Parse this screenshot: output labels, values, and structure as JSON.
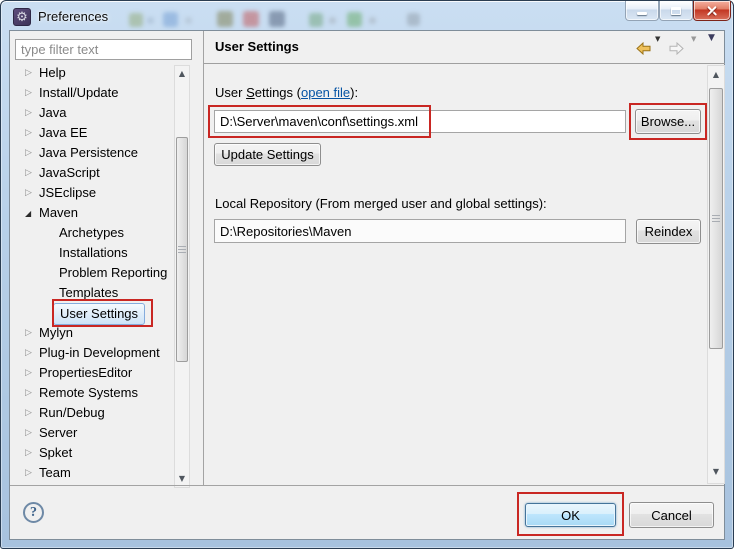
{
  "window": {
    "title": "Preferences",
    "controls": [
      {
        "name": "minimize"
      },
      {
        "name": "maximize"
      },
      {
        "name": "close"
      }
    ]
  },
  "icons": {
    "gear": "⚙",
    "collapsed_glyph": "▷",
    "expanded_glyph": "◢",
    "scroll_up": "▲",
    "scroll_down": "▼",
    "dropdown": "▼",
    "nav_menu": "▼"
  },
  "sidebar": {
    "filter_placeholder": "type filter text",
    "tree": [
      {
        "label": "Help",
        "state": "collapsed",
        "level": 0
      },
      {
        "label": "Install/Update",
        "state": "collapsed",
        "level": 0
      },
      {
        "label": "Java",
        "state": "collapsed",
        "level": 0
      },
      {
        "label": "Java EE",
        "state": "collapsed",
        "level": 0
      },
      {
        "label": "Java Persistence",
        "state": "collapsed",
        "level": 0
      },
      {
        "label": "JavaScript",
        "state": "collapsed",
        "level": 0
      },
      {
        "label": "JSEclipse",
        "state": "collapsed",
        "level": 0
      },
      {
        "label": "Maven",
        "state": "expanded",
        "level": 0
      },
      {
        "label": "Archetypes",
        "state": "leaf",
        "level": 1
      },
      {
        "label": "Installations",
        "state": "leaf",
        "level": 1
      },
      {
        "label": "Problem Reporting",
        "state": "leaf",
        "level": 1
      },
      {
        "label": "Templates",
        "state": "leaf",
        "level": 1
      },
      {
        "label": "User Settings",
        "state": "leaf",
        "level": 1,
        "selected": true,
        "annotated": true
      },
      {
        "label": "Mylyn",
        "state": "collapsed",
        "level": 0
      },
      {
        "label": "Plug-in Development",
        "state": "collapsed",
        "level": 0
      },
      {
        "label": "PropertiesEditor",
        "state": "collapsed",
        "level": 0
      },
      {
        "label": "Remote Systems",
        "state": "collapsed",
        "level": 0
      },
      {
        "label": "Run/Debug",
        "state": "collapsed",
        "level": 0
      },
      {
        "label": "Server",
        "state": "collapsed",
        "level": 0
      },
      {
        "label": "Spket",
        "state": "collapsed",
        "level": 0
      },
      {
        "label": "Team",
        "state": "collapsed",
        "level": 0
      }
    ]
  },
  "header": {
    "title": "User Settings"
  },
  "main": {
    "user_settings": {
      "label_prefix": "User ",
      "label_mnemonic": "S",
      "label_mid": "ettings (",
      "open_file_link": "open file",
      "label_suffix": "):",
      "path_value": "D:\\Server\\maven\\conf\\settings.xml",
      "browse_button": "Browse...",
      "update_button": "Update Settings"
    },
    "local_repository": {
      "label": "Local Repository (From merged user and global settings):",
      "path_value": "D:\\Repositories\\Maven",
      "reindex_button": "Reindex"
    }
  },
  "footer": {
    "help_glyph": "?",
    "ok_button": "OK",
    "cancel_button": "Cancel"
  },
  "colors": {
    "annotation": "#c92723",
    "link": "#0553a4",
    "selection_border": "#84acdd",
    "titlebar": "#b6cfe8"
  }
}
